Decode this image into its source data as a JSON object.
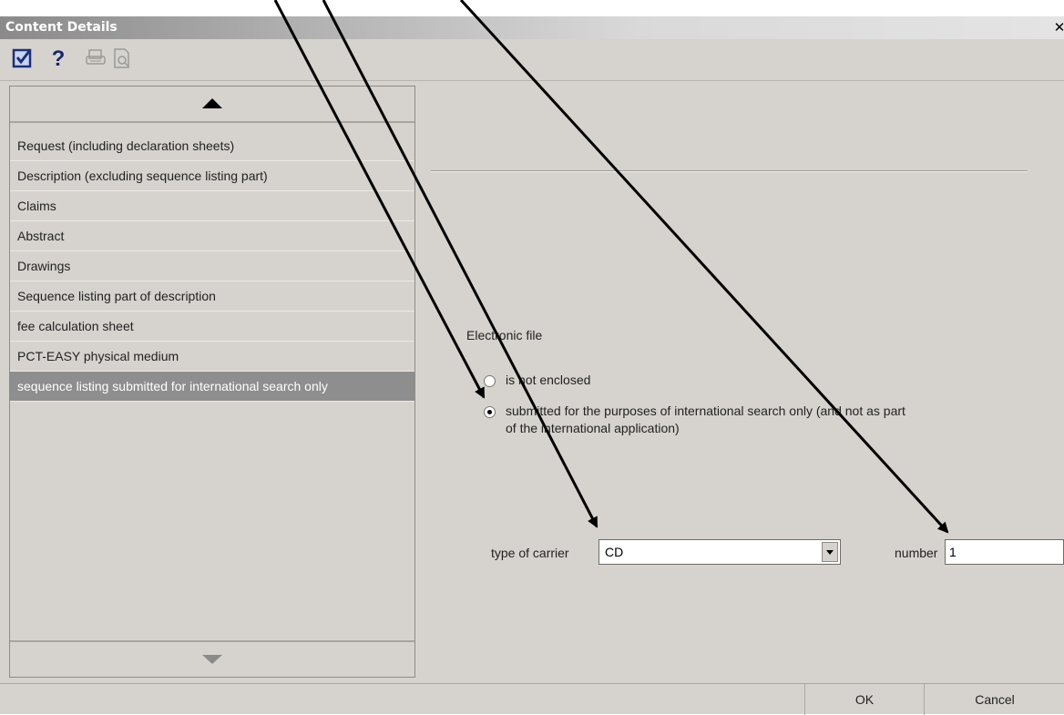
{
  "window": {
    "title": "Content Details",
    "close_glyph": "✕"
  },
  "toolbar": {
    "icons": [
      "checkbox-icon",
      "help-icon",
      "print-icon",
      "print-preview-icon"
    ],
    "help_glyph": "?"
  },
  "left_panel": {
    "items": [
      {
        "label": "Request (including declaration sheets)",
        "selected": false
      },
      {
        "label": "Description (excluding sequence listing part)",
        "selected": false
      },
      {
        "label": "Claims",
        "selected": false
      },
      {
        "label": "Abstract",
        "selected": false
      },
      {
        "label": "Drawings",
        "selected": false
      },
      {
        "label": "Sequence listing part of description",
        "selected": false
      },
      {
        "label": "fee calculation sheet",
        "selected": false
      },
      {
        "label": "PCT-EASY physical medium",
        "selected": false
      },
      {
        "label": "sequence listing submitted for international search only",
        "selected": true
      }
    ]
  },
  "right_panel": {
    "section_label": "Electronic file",
    "radio_options": [
      {
        "label": "is not enclosed",
        "checked": false
      },
      {
        "label_line1": "submitted for the purposes of international search only (and not as part",
        "label_line2": "of the international application)",
        "checked": true
      }
    ],
    "carrier_label": "type of carrier",
    "carrier_value": "CD",
    "number_label": "number",
    "number_value": "1"
  },
  "buttons": {
    "ok_label": "OK",
    "cancel_label": "Cancel"
  },
  "colors": {
    "window_bg": "#d6d3ce",
    "selected_bg": "#8e8e8e",
    "arrow": "#000000"
  }
}
